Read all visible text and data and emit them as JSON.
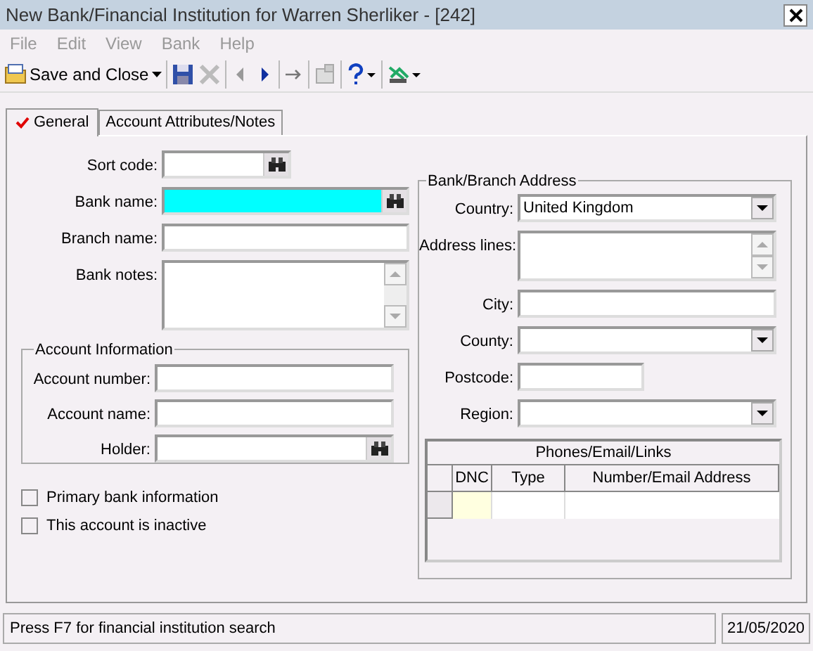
{
  "window": {
    "title": "New Bank/Financial Institution for Warren Sherliker - [242]"
  },
  "menu": [
    {
      "label": "File",
      "disabled": true
    },
    {
      "label": "Edit",
      "disabled": true
    },
    {
      "label": "View",
      "disabled": true
    },
    {
      "label": "Bank",
      "disabled": true
    },
    {
      "label": "Help",
      "disabled": true
    }
  ],
  "toolbar": {
    "save_and_close": "Save and Close"
  },
  "tabs": [
    {
      "label": "General",
      "selected": true,
      "valid": true
    },
    {
      "label": "Account Attributes/Notes",
      "selected": false,
      "valid": false
    }
  ],
  "bank_fields": [
    {
      "label": "Sort code:",
      "kind": "lookup",
      "short": true,
      "focused": false
    },
    {
      "label": "Bank name:",
      "kind": "lookup",
      "short": false,
      "focused": true
    },
    {
      "label": "Branch name:",
      "kind": "text",
      "short": false,
      "focused": false
    },
    {
      "label": "Bank notes:",
      "kind": "memo",
      "short": false,
      "focused": false
    }
  ],
  "account_information": {
    "title": "Account Information",
    "fields": [
      {
        "label": "Account number:",
        "kind": "text"
      },
      {
        "label": "Account name:",
        "kind": "text"
      },
      {
        "label": "Holder:",
        "kind": "lookup"
      }
    ]
  },
  "checkboxes": [
    {
      "label": "Primary bank information",
      "checked": false
    },
    {
      "label": "This account is inactive",
      "checked": false
    }
  ],
  "address": {
    "title": "Bank/Branch Address",
    "fields": [
      {
        "label": "Country:",
        "kind": "dropdown",
        "value": "United Kingdom"
      },
      {
        "label": "Address lines:",
        "kind": "memo"
      },
      {
        "label": "City:",
        "kind": "text"
      },
      {
        "label": "County:",
        "kind": "dropdown"
      },
      {
        "label": "Postcode:",
        "kind": "short"
      },
      {
        "label": "Region:",
        "kind": "dropdown"
      }
    ]
  },
  "contacts_grid": {
    "title": "Phones/Email/Links",
    "columns": [
      "DNC",
      "Type",
      "Number/Email Address"
    ]
  },
  "status_bar": {
    "message": "Press F7 for financial institution search",
    "date": "21/05/2020"
  }
}
